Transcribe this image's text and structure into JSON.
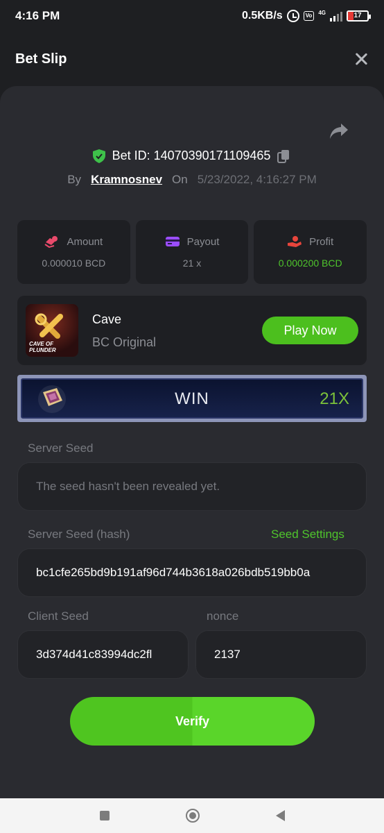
{
  "status_bar": {
    "time": "4:16 PM",
    "network_speed": "0.5KB/s",
    "volte": "VoLTE",
    "net_type": "4G",
    "battery": "17"
  },
  "header": {
    "title": "Bet Slip"
  },
  "bet": {
    "id_text": "Bet ID: 14070390171109465",
    "by_label": "By",
    "username": "Kramnosnev",
    "on_label": "On",
    "datetime": "5/23/2022, 4:16:27 PM"
  },
  "stats": [
    {
      "label": "Amount",
      "value": "0.000010 BCD",
      "icon": "money-icon"
    },
    {
      "label": "Payout",
      "value": "21 x",
      "icon": "card-icon"
    },
    {
      "label": "Profit",
      "value": "0.000200 BCD",
      "icon": "profit-icon"
    }
  ],
  "game": {
    "name": "Cave",
    "provider": "BC Original",
    "thumb_text": "CAVE OF PLUNDER",
    "play_label": "Play Now"
  },
  "result": {
    "label": "WIN",
    "multiplier": "21X"
  },
  "server_seed": {
    "label": "Server Seed",
    "value": "The seed hasn't been revealed yet."
  },
  "server_seed_hash": {
    "label": "Server Seed (hash)",
    "settings_link": "Seed Settings",
    "value": "bc1cfe265bd9b191af96d744b3618a026bdb519bb0a"
  },
  "client_seed": {
    "label": "Client Seed",
    "value": "3d374d41c83994dc2fl"
  },
  "nonce": {
    "label": "nonce",
    "value": "2137"
  },
  "verify_label": "Verify",
  "colors": {
    "accent_green": "#4fc52c",
    "background": "#1e1f22",
    "sheet": "#2a2b30"
  }
}
